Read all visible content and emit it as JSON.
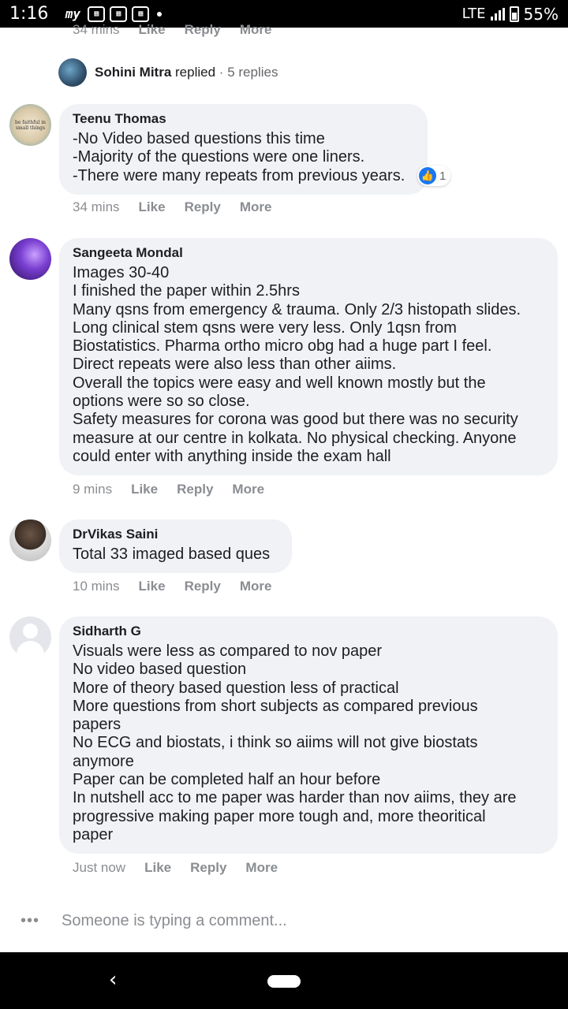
{
  "status_bar": {
    "time": "1:16",
    "network": "LTE",
    "battery": "55%",
    "icons": [
      "mi-icon",
      "sim-app-icon",
      "sim-app-icon",
      "sim-app-icon",
      "notification-dot"
    ]
  },
  "top_meta": {
    "time": "34 mins",
    "like": "Like",
    "reply": "Reply",
    "more": "More"
  },
  "replied": {
    "name": "Sohini Mitra",
    "action": "replied",
    "separator": "·",
    "count": "5 replies"
  },
  "comments": [
    {
      "author": "Teenu Thomas",
      "text": "-No Video based questions this time\n-Majority of the questions were one liners.\n-There were many repeats from previous years.",
      "reaction_count": "1",
      "time": "34 mins",
      "like": "Like",
      "reply": "Reply",
      "more": "More"
    },
    {
      "author": "Sangeeta Mondal",
      "text": "Images 30-40\nI finished the paper within 2.5hrs\nMany qsns from emergency & trauma. Only 2/3 histopath slides.\nLong clinical stem qsns were very less. Only 1qsn from\nBiostatistics. Pharma ortho micro obg had a huge part I feel.\nDirect repeats were also less than other aiims.\nOverall the topics were easy and well known mostly but the\noptions were so so close.\nSafety measures for corona was good but there was no security\nmeasure at our centre in kolkata. No physical checking. Anyone\ncould enter with anything inside the exam hall",
      "time": "9 mins",
      "like": "Like",
      "reply": "Reply",
      "more": "More"
    },
    {
      "author": "DrVikas Saini",
      "text": "Total 33 imaged based ques",
      "time": "10 mins",
      "like": "Like",
      "reply": "Reply",
      "more": "More"
    },
    {
      "author": "Sidharth G",
      "text": "Visuals were less as compared to nov paper\nNo video based question\nMore of theory based question less of practical\nMore questions from short subjects as compared previous\npapers\nNo ECG and biostats, i think so aiims will not give biostats\nanymore\nPaper can be completed half an hour before\nIn nutshell acc to me paper was harder than nov aiims, they are\nprogressive making paper more tough and, more theoritical\npaper",
      "time": "Just now",
      "like": "Like",
      "reply": "Reply",
      "more": "More"
    }
  ],
  "typing": {
    "dots": "•••",
    "text": "Someone is typing a comment..."
  },
  "nav": {
    "back": "‹"
  }
}
